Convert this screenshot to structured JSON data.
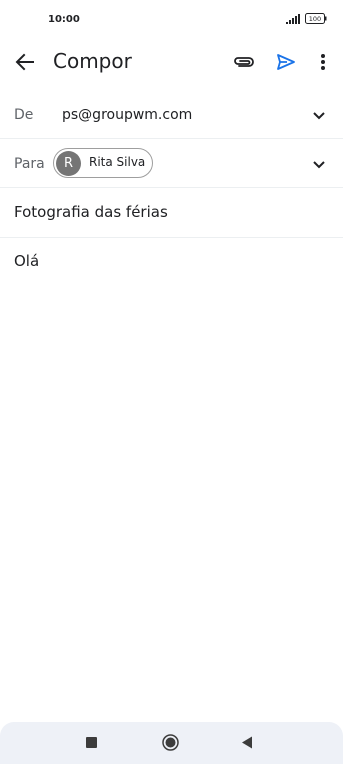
{
  "status_bar": {
    "time": "10:00",
    "battery": "100",
    "icons": [
      "signal-icon",
      "battery-icon"
    ]
  },
  "app_bar": {
    "title": "Compor",
    "icons": [
      "back-arrow-icon",
      "attach-icon",
      "send-icon",
      "more-vert-icon"
    ],
    "send_color": "#1a73e8"
  },
  "compose": {
    "from": {
      "label": "De",
      "value": "ps@groupwm.com"
    },
    "to": {
      "label": "Para",
      "recipient": {
        "initial": "R",
        "name": "Rita Silva"
      }
    },
    "subject": "Fotografia das férias",
    "body": "Olá"
  },
  "nav_bar": {
    "icons": [
      "recents-icon",
      "home-icon",
      "back-icon"
    ]
  }
}
